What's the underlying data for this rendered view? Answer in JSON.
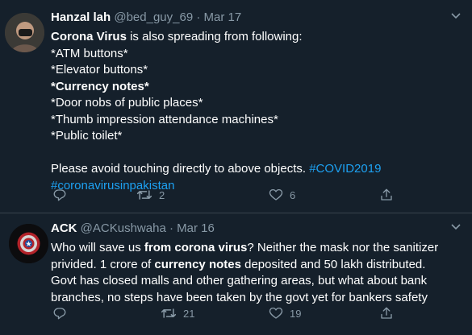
{
  "tweets": [
    {
      "name": "Hanzal lah",
      "handle": "@bed_guy_69",
      "sep": "·",
      "date": "Mar 17",
      "lines": [
        {
          "b": "Corona Virus",
          "t": " is also spreading from following:"
        },
        {
          "t": "*ATM buttons*"
        },
        {
          "t": "*Elevator buttons*"
        },
        {
          "b": "*Currency notes*"
        },
        {
          "t": "*Door nobs of public places*"
        },
        {
          "t": "*Thumb impression attendance machines*"
        },
        {
          "t": "*Public toilet*"
        }
      ],
      "footer_text": "Please avoid touching directly to above objects. ",
      "hashtag1": "#COVID2019",
      "hashtag2": "#coronavirusinpakistan",
      "retweets": "2",
      "likes": "6"
    },
    {
      "name": "ACK",
      "handle": "@ACKushwaha",
      "sep": "·",
      "date": "Mar 16",
      "text": [
        {
          "t": "Who will save us "
        },
        {
          "b": "from corona virus"
        },
        {
          "t": "? Neither the mask nor the sanitizer"
        },
        {
          "br": true
        },
        {
          "t": "privided. 1 crore of "
        },
        {
          "b": "currency notes"
        },
        {
          "t": " deposited and 50 lakh distributed."
        },
        {
          "br": true
        },
        {
          "t": "Govt has closed malls and other gathering areas, but what about bank"
        },
        {
          "br": true
        },
        {
          "t": "branches, no steps have been taken by the govt yet for bankers safety"
        }
      ],
      "retweets": "21",
      "likes": "19"
    }
  ],
  "icons": {
    "reply": "reply-icon",
    "retweet": "retweet-icon",
    "like": "like-icon",
    "share": "share-icon",
    "caret": "chevron-down-icon"
  },
  "colors": {
    "background": "#15202b",
    "secondary_text": "#8899a6",
    "link": "#1da1f2",
    "divider": "#38444d"
  }
}
